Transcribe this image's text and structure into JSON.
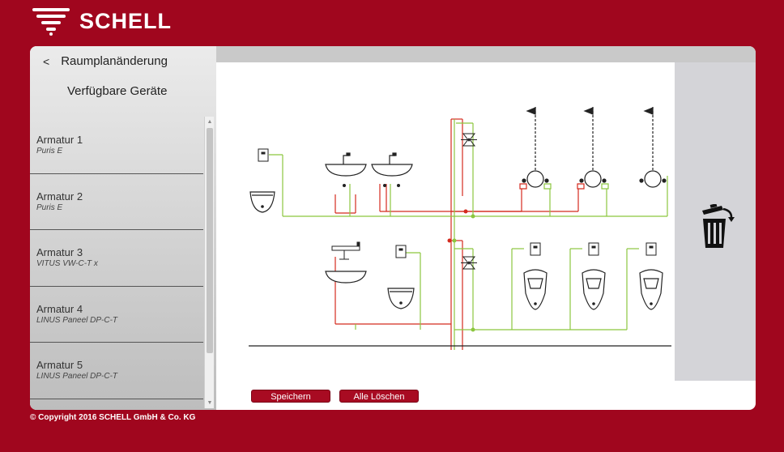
{
  "brand": {
    "name": "SCHELL"
  },
  "sidebar": {
    "back_label": "<",
    "title": "Raumplanänderung",
    "subtitle": "Verfügbare Geräte",
    "devices": [
      {
        "name": "Armatur 1",
        "model": "Puris E"
      },
      {
        "name": "Armatur 2",
        "model": "Puris E"
      },
      {
        "name": "Armatur 3",
        "model": "VITUS VW-C-T x"
      },
      {
        "name": "Armatur 4",
        "model": "LINUS Paneel DP-C-T"
      },
      {
        "name": "Armatur 5",
        "model": "LINUS Paneel DP-C-T"
      }
    ]
  },
  "canvas": {
    "icons": [
      "control-box-icon",
      "wc-icon",
      "washbasin-icon",
      "shower-icon",
      "urinal-icon",
      "valve-icon",
      "thermostat-mixer-icon"
    ],
    "colors": {
      "hot_line": "#d42a1e",
      "cold_line": "#8cc63f",
      "fixture": "#222222"
    },
    "trash_icon": "trash-icon"
  },
  "buttons": {
    "save": "Speichern",
    "clear_all": "Alle Löschen"
  },
  "footer": {
    "copyright": "© Copyright 2016 SCHELL GmbH & Co. KG"
  }
}
